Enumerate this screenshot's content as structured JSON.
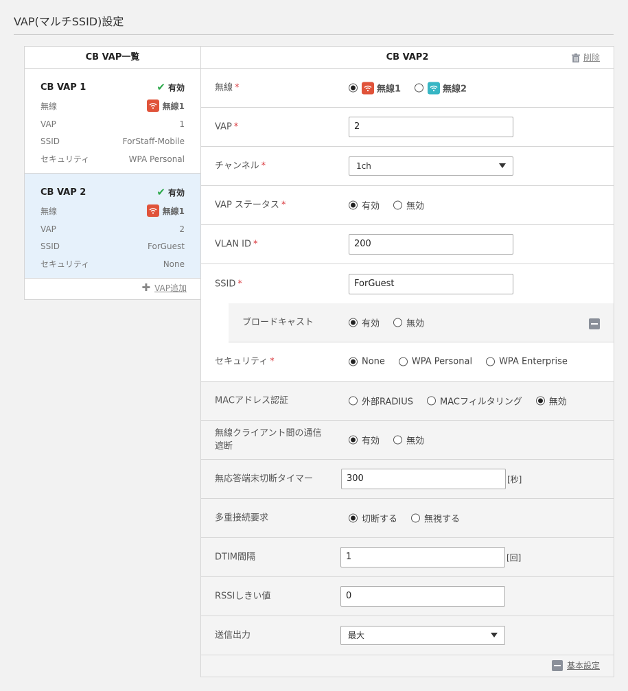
{
  "page": {
    "title": "VAP(マルチSSID)設定"
  },
  "list": {
    "header": "CB VAP一覧",
    "cards": [
      {
        "name": "CB VAP 1",
        "status": "有効",
        "radio_label": "無線",
        "radio_value": "無線1",
        "vap_label": "VAP",
        "vap_value": "1",
        "ssid_label": "SSID",
        "ssid_value": "ForStaff-Mobile",
        "security_label": "セキュリティ",
        "security_value": "WPA Personal"
      },
      {
        "name": "CB VAP 2",
        "status": "有効",
        "radio_label": "無線",
        "radio_value": "無線1",
        "vap_label": "VAP",
        "vap_value": "2",
        "ssid_label": "SSID",
        "ssid_value": "ForGuest",
        "security_label": "セキュリティ",
        "security_value": "None"
      }
    ],
    "add_label": "VAP追加"
  },
  "detail": {
    "header": "CB VAP2",
    "delete_label": "削除",
    "radio": {
      "label": "無線",
      "options": [
        "無線1",
        "無線2"
      ],
      "selected": 0
    },
    "vap": {
      "label": "VAP",
      "value": "2"
    },
    "channel": {
      "label": "チャンネル",
      "value": "1ch"
    },
    "vap_status": {
      "label": "VAP ステータス",
      "options": [
        "有効",
        "無効"
      ],
      "selected": 0
    },
    "vlan": {
      "label": "VLAN ID",
      "value": "200"
    },
    "ssid": {
      "label": "SSID",
      "value": "ForGuest"
    },
    "broadcast": {
      "label": "ブロードキャスト",
      "options": [
        "有効",
        "無効"
      ],
      "selected": 0
    },
    "security": {
      "label": "セキュリティ",
      "options": [
        "None",
        "WPA Personal",
        "WPA Enterprise"
      ],
      "selected": 0
    },
    "mac_auth": {
      "label": "MACアドレス認証",
      "options": [
        "外部RADIUS",
        "MACフィルタリング",
        "無効"
      ],
      "selected": 2
    },
    "isolation": {
      "label_line1": "無線クライアント間の通信",
      "label_line2": "遮断",
      "options": [
        "有効",
        "無効"
      ],
      "selected": 0
    },
    "idle_timer": {
      "label": "無応答端末切断タイマー",
      "value": "300",
      "unit": "[秒]"
    },
    "multi_conn": {
      "label": "多重接続要求",
      "options": [
        "切断する",
        "無視する"
      ],
      "selected": 0
    },
    "dtim": {
      "label": "DTIM間隔",
      "value": "1",
      "unit": "[回]"
    },
    "rssi": {
      "label": "RSSIしきい値",
      "value": "0"
    },
    "tx_power": {
      "label": "送信出力",
      "value": "最大"
    },
    "footer_label": "基本設定"
  },
  "colors": {
    "radio1": "#e0533a",
    "radio2": "#37b6c4",
    "check": "#2ca84a",
    "required": "#d9373c",
    "selected_card": "#e6f1fb"
  }
}
